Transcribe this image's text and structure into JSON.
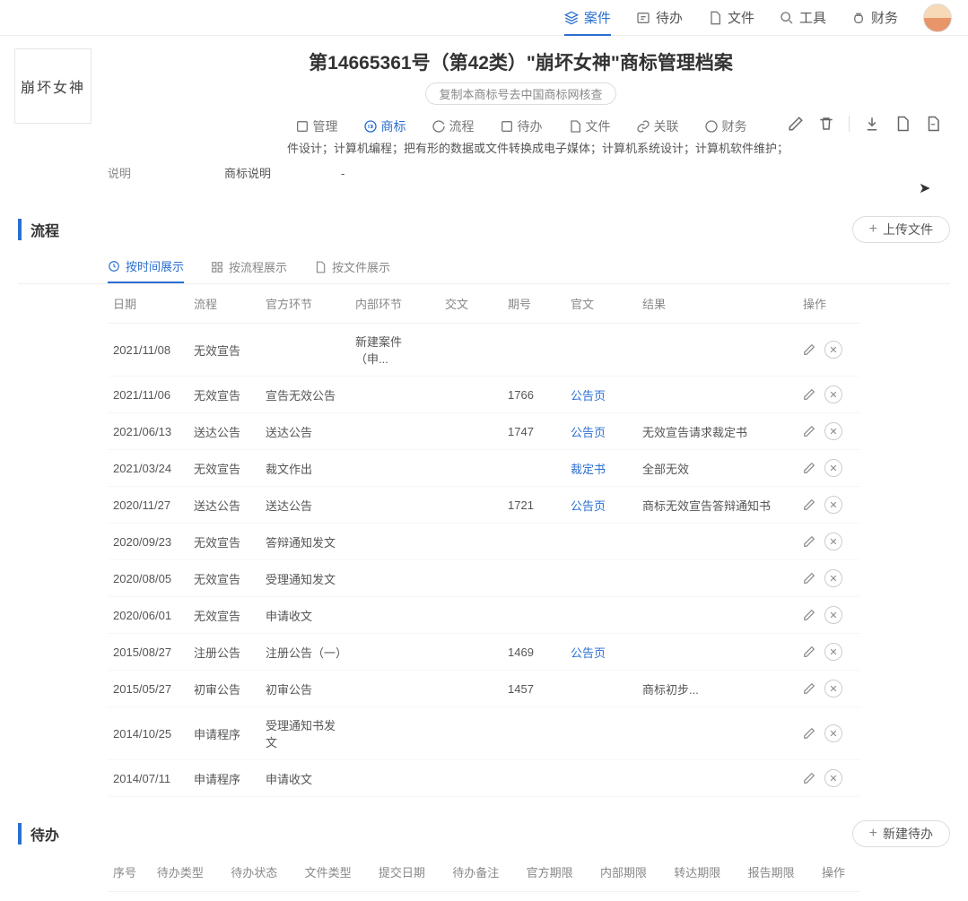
{
  "topnav": {
    "cases": "案件",
    "todo": "待办",
    "files": "文件",
    "tools": "工具",
    "finance": "财务"
  },
  "logo": "崩坏女神",
  "title": "第14665361号（第42类）\"崩坏女神\"商标管理档案",
  "subtitle": "复制本商标号去中国商标网核查",
  "tabs": {
    "manage": "管理",
    "mark": "商标",
    "flow": "流程",
    "todo": "待办",
    "files": "文件",
    "rel": "关联",
    "fin": "财务"
  },
  "info_service_text": "件设计；计算机编程；把有形的数据或文件转换成电子媒体；计算机系统设计；计算机软件维护；",
  "desc_label": "说明",
  "desc_mid": "商标说明",
  "desc_val": "-",
  "flow_section": "流程",
  "upload_btn": "上传文件",
  "subtabs": {
    "bytime": "按时间展示",
    "byflow": "按流程展示",
    "byfile": "按文件展示"
  },
  "flow_cols": {
    "date": "日期",
    "flow": "流程",
    "off": "官方环节",
    "inner": "内部环节",
    "jw": "交文",
    "issue": "期号",
    "doc": "官文",
    "result": "结果",
    "op": "操作"
  },
  "flow_rows": [
    {
      "date": "2021/11/08",
      "flow": "无效宣告",
      "off": "",
      "inner": "新建案件（申...",
      "issue": "",
      "doc": "",
      "result": ""
    },
    {
      "date": "2021/11/06",
      "flow": "无效宣告",
      "off": "宣告无效公告",
      "inner": "",
      "issue": "1766",
      "doc": "公告页",
      "result": ""
    },
    {
      "date": "2021/06/13",
      "flow": "送达公告",
      "off": "送达公告",
      "inner": "",
      "issue": "1747",
      "doc": "公告页",
      "result": "无效宣告请求裁定书"
    },
    {
      "date": "2021/03/24",
      "flow": "无效宣告",
      "off": "裁文作出",
      "inner": "",
      "issue": "",
      "doc": "裁定书",
      "result": "全部无效"
    },
    {
      "date": "2020/11/27",
      "flow": "送达公告",
      "off": "送达公告",
      "inner": "",
      "issue": "1721",
      "doc": "公告页",
      "result": "商标无效宣告答辩通知书"
    },
    {
      "date": "2020/09/23",
      "flow": "无效宣告",
      "off": "答辩通知发文",
      "inner": "",
      "issue": "",
      "doc": "",
      "result": ""
    },
    {
      "date": "2020/08/05",
      "flow": "无效宣告",
      "off": "受理通知发文",
      "inner": "",
      "issue": "",
      "doc": "",
      "result": ""
    },
    {
      "date": "2020/06/01",
      "flow": "无效宣告",
      "off": "申请收文",
      "inner": "",
      "issue": "",
      "doc": "",
      "result": ""
    },
    {
      "date": "2015/08/27",
      "flow": "注册公告",
      "off": "注册公告（一）",
      "inner": "",
      "issue": "1469",
      "doc": "公告页",
      "result": ""
    },
    {
      "date": "2015/05/27",
      "flow": "初审公告",
      "off": "初审公告",
      "inner": "",
      "issue": "1457",
      "doc": "",
      "result": "商标初步..."
    },
    {
      "date": "2014/10/25",
      "flow": "申请程序",
      "off": "受理通知书发文",
      "inner": "",
      "issue": "",
      "doc": "",
      "result": ""
    },
    {
      "date": "2014/07/11",
      "flow": "申请程序",
      "off": "申请收文",
      "inner": "",
      "issue": "",
      "doc": "",
      "result": ""
    }
  ],
  "todo_section": "待办",
  "new_todo_btn": "新建待办",
  "todo_cols": {
    "no": "序号",
    "type": "待办类型",
    "status": "待办状态",
    "ftype": "文件类型",
    "submit": "提交日期",
    "note": "待办备注",
    "offdue": "官方期限",
    "innerdue": "内部期限",
    "forward": "转达期限",
    "report": "报告期限",
    "op": "操作"
  }
}
